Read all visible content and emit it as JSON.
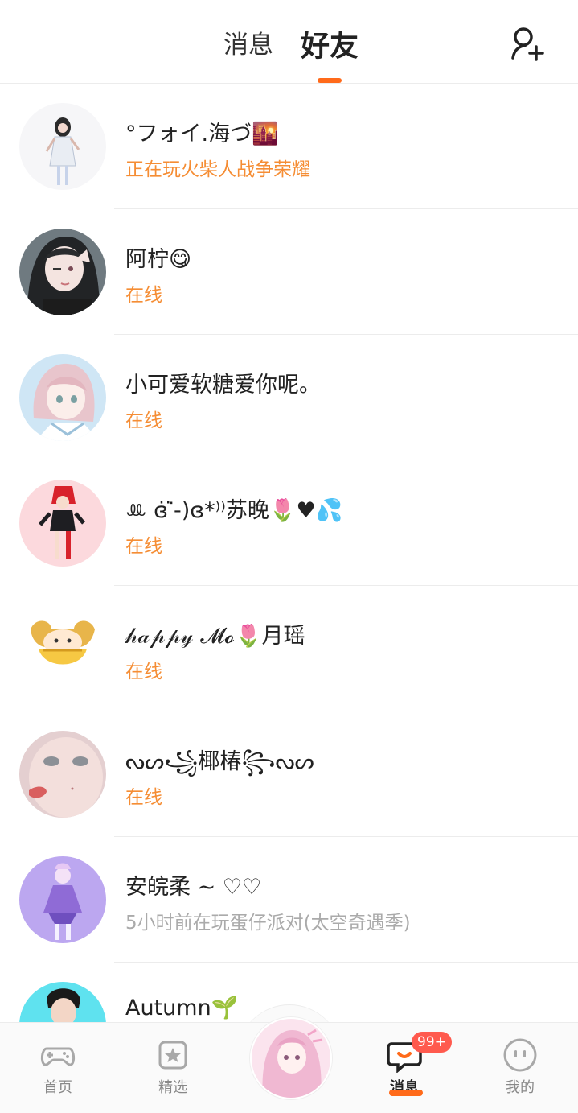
{
  "header": {
    "tabs": [
      {
        "label": "消息"
      },
      {
        "label": "好友"
      }
    ],
    "add_friend_icon": "add-person-icon",
    "accent": "#ff6a1a"
  },
  "friends": [
    {
      "name": "°フォイ.海づ🌇",
      "status": "正在玩火柴人战争荣耀",
      "status_color": "#f58d34"
    },
    {
      "name": "阿柠😋",
      "status": "在线",
      "status_color": "#f58d34"
    },
    {
      "name": "小可爱软糖爱你呢。",
      "status": "在线",
      "status_color": "#f58d34"
    },
    {
      "name": "ꔛ ɞ̇ᐝ̇-)ɞ*⁾⁾苏晚🌷♥💦",
      "status": "在线",
      "status_color": "#f58d34"
    },
    {
      "name": "𝒽𝒶𝓅𝓅𝓎 𝓜𝓸🌷月瑶",
      "status": "在线",
      "status_color": "#f58d34"
    },
    {
      "name": "ᔓᔕ꧁椰椿꧂ᔓᔕ",
      "status": "在线",
      "status_color": "#f58d34"
    },
    {
      "name": "安皖柔 ~ ♡♡",
      "status": "5小时前在玩蛋仔派对(太空奇遇季)",
      "status_color": "#aaaaaa"
    },
    {
      "name": "Autumn🌱",
      "status": "",
      "status_color": "#f58d34"
    }
  ],
  "bottom_nav": {
    "items": [
      {
        "label": "首页",
        "icon": "gamepad-icon"
      },
      {
        "label": "精选",
        "icon": "star-bookmark-icon"
      },
      {
        "label": "消息",
        "icon": "chat-bubble-icon",
        "badge": "99+"
      },
      {
        "label": "我的",
        "icon": "face-icon"
      }
    ]
  }
}
